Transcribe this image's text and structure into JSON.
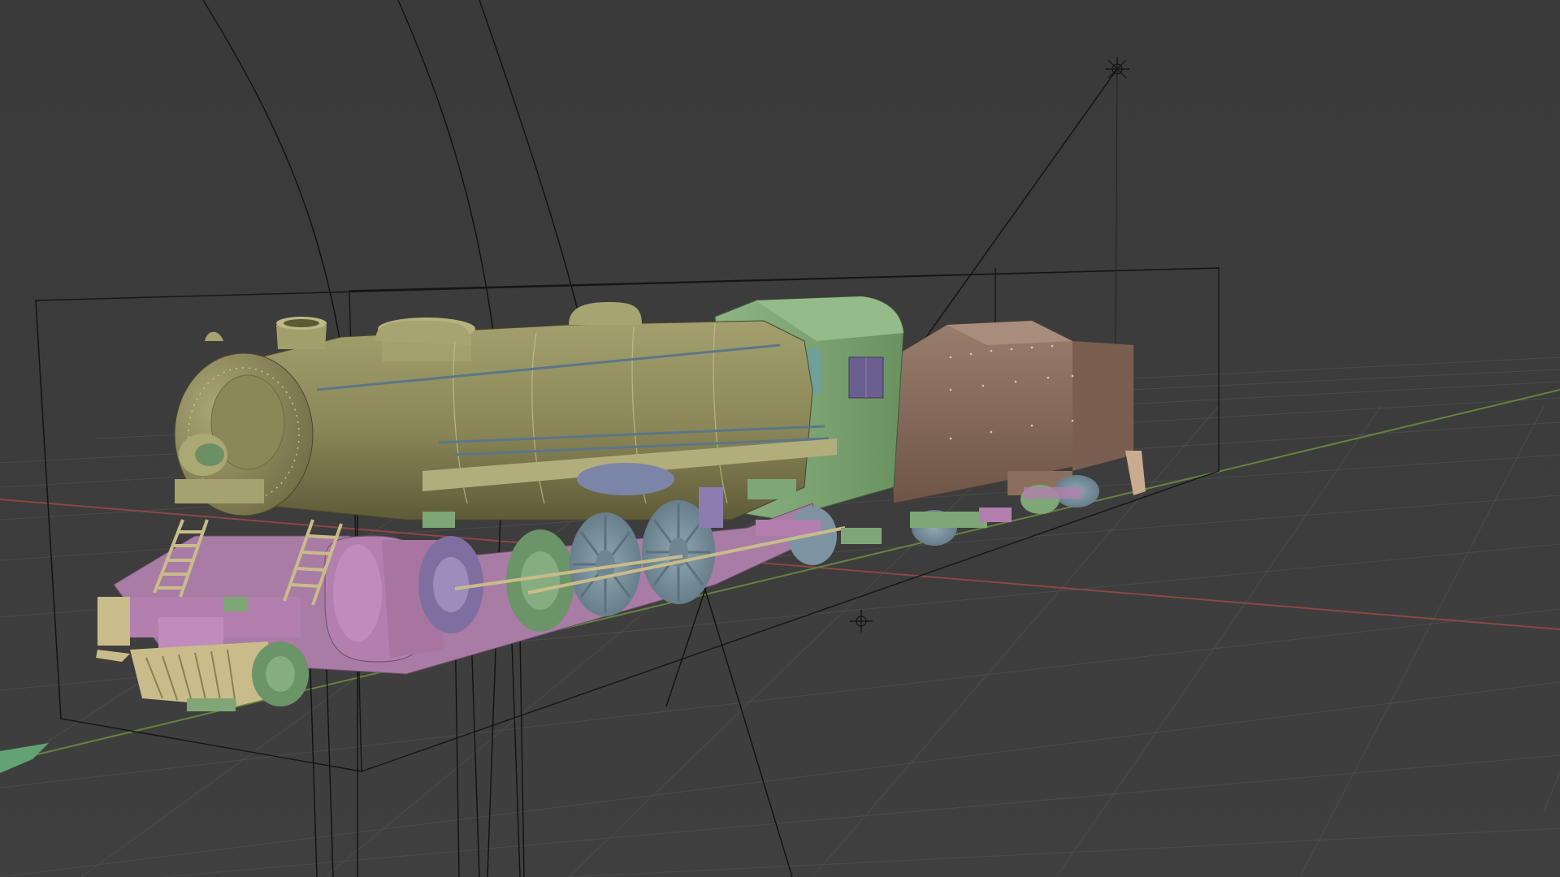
{
  "viewport": {
    "name": "3D Viewport",
    "shading": "solid",
    "object_type": "steam locomotive with tender"
  },
  "colors": {
    "background": "#3c3c3c",
    "grid": "#4c4c4c",
    "x_axis": "#9a4a4a",
    "y_axis": "#6c8a46",
    "boiler": "#8e8a5c",
    "cab": "#7fa677",
    "tender": "#8a6e5e",
    "frame": "#b27fae",
    "wheels": "#7d93a1",
    "ladder": "#c9bc8a",
    "bounding_box": "#111111"
  },
  "icons": [
    "light-object-icon",
    "empty-object-icon"
  ]
}
